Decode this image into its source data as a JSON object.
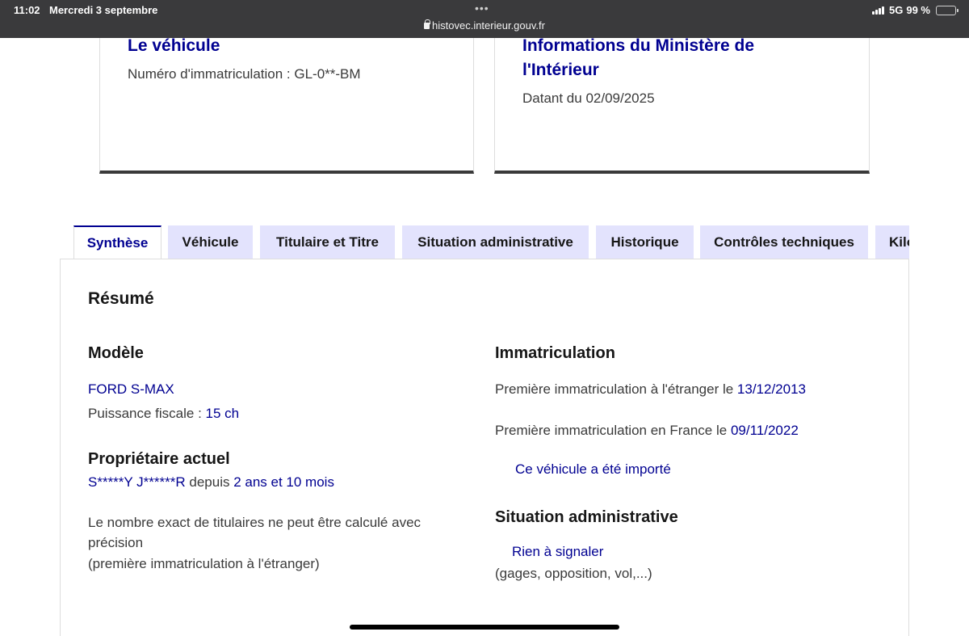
{
  "status_bar": {
    "time": "11:02",
    "date": "Mercredi 3 septembre",
    "url": "histovec.interieur.gouv.fr",
    "network": "5G",
    "battery": "99 %",
    "more_dots": "•••"
  },
  "cards": {
    "vehicle": {
      "title": "Le véhicule",
      "registration": "Numéro d'immatriculation : GL-0**-BM"
    },
    "ministry": {
      "title": "Informations du Ministère de l'Intérieur",
      "date": "Datant du 02/09/2025"
    }
  },
  "tabs": [
    {
      "label": "Synthèse",
      "active": true
    },
    {
      "label": "Véhicule",
      "active": false
    },
    {
      "label": "Titulaire et Titre",
      "active": false
    },
    {
      "label": "Situation administrative",
      "active": false
    },
    {
      "label": "Historique",
      "active": false
    },
    {
      "label": "Contrôles techniques",
      "active": false
    },
    {
      "label": "Kilométrage",
      "active": false
    }
  ],
  "summary": {
    "title": "Résumé",
    "model": {
      "heading": "Modèle",
      "name": "FORD S-MAX",
      "power_label": "Puissance fiscale : ",
      "power_value": "15 ch"
    },
    "owner": {
      "heading": "Propriétaire actuel",
      "name": "S*****Y J******R",
      "since_label": " depuis ",
      "since_value": "2 ans et 10 mois",
      "note_line1": "Le nombre exact de titulaires ne peut être calculé avec",
      "note_line2": "précision",
      "note_line3": "(première immatriculation à l'étranger)"
    },
    "registration": {
      "heading": "Immatriculation",
      "foreign_label": "Première immatriculation à l'étranger le ",
      "foreign_date": "13/12/2013",
      "france_label": "Première immatriculation en France le ",
      "france_date": "09/11/2022",
      "imported": "Ce véhicule a été importé"
    },
    "admin": {
      "heading": "Situation administrative",
      "status": "Rien à signaler",
      "detail": "(gages, opposition, vol,...)"
    }
  },
  "colors": {
    "brand_blue": "#000091",
    "tab_bg": "#e3e3fd",
    "status_bar_bg": "#3a3a3c"
  }
}
